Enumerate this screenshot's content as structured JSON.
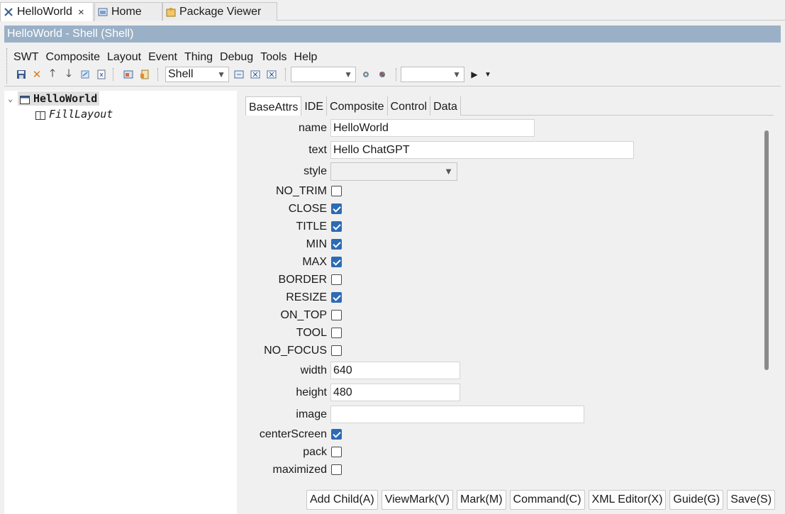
{
  "editor_tabs": [
    {
      "label": "HelloWorld",
      "close": "×"
    },
    {
      "label": "Home"
    },
    {
      "label": "Package Viewer"
    }
  ],
  "window_title": "HelloWorld - Shell  (Shell)",
  "menu": [
    "SWT",
    "Composite",
    "Layout",
    "Event",
    "Thing",
    "Debug",
    "Tools",
    "Help"
  ],
  "toolbar": {
    "type_combo": "Shell",
    "combo2": "",
    "combo3": ""
  },
  "tree": {
    "root": "HelloWorld",
    "child": "FillLayout"
  },
  "attr_tabs": [
    "BaseAttrs",
    "IDE",
    "Composite",
    "Control",
    "Data"
  ],
  "fields": {
    "name": {
      "label": "name",
      "value": "HelloWorld"
    },
    "text": {
      "label": "text",
      "value": "Hello ChatGPT"
    },
    "style": {
      "label": "style",
      "value": ""
    },
    "width": {
      "label": "width",
      "value": "640"
    },
    "height": {
      "label": "height",
      "value": "480"
    },
    "image": {
      "label": "image",
      "value": ""
    }
  },
  "checkboxes": [
    {
      "label": "NO_TRIM",
      "checked": false
    },
    {
      "label": "CLOSE",
      "checked": true
    },
    {
      "label": "TITLE",
      "checked": true
    },
    {
      "label": "MIN",
      "checked": true
    },
    {
      "label": "MAX",
      "checked": true
    },
    {
      "label": "BORDER",
      "checked": false
    },
    {
      "label": "RESIZE",
      "checked": true
    },
    {
      "label": "ON_TOP",
      "checked": false
    },
    {
      "label": "TOOL",
      "checked": false
    },
    {
      "label": "NO_FOCUS",
      "checked": false
    }
  ],
  "checkboxes2": [
    {
      "label": "centerScreen",
      "checked": true
    },
    {
      "label": "pack",
      "checked": false
    },
    {
      "label": "maximized",
      "checked": false
    }
  ],
  "buttons": {
    "add_child": "Add Child(A)",
    "view_mark": "ViewMark(V)",
    "mark": "Mark(M)",
    "command": "Command(C)",
    "xml_editor": "XML Editor(X)",
    "guide": "Guide(G)",
    "save": "Save(S)"
  },
  "colors": {
    "title_bar": "#9ab0c6",
    "checkbox_checked": "#2c6bb5"
  }
}
